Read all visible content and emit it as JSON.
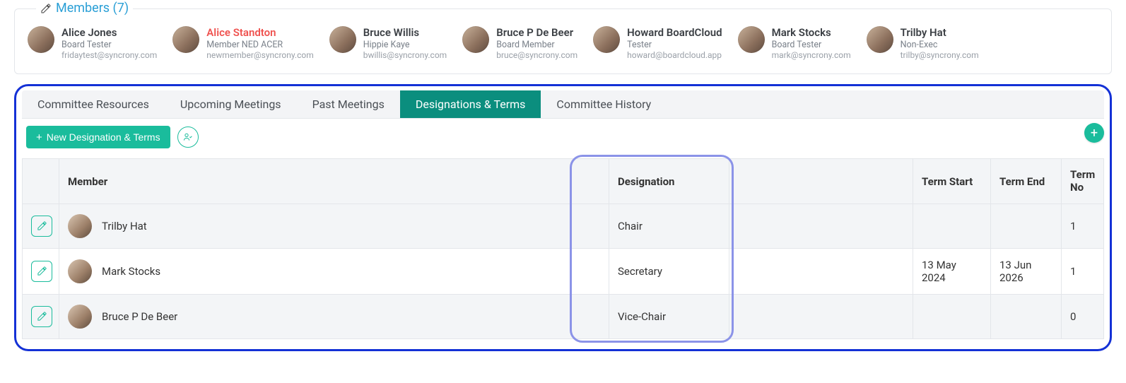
{
  "members_panel": {
    "title": "Members (7)",
    "items": [
      {
        "name": "Alice Jones",
        "role": "Board Tester",
        "email": "fridaytest@syncrony.com",
        "highlight": false
      },
      {
        "name": "Alice Standton",
        "role": "Member NED ACER",
        "email": "newmember@syncrony.com",
        "highlight": true
      },
      {
        "name": "Bruce Willis",
        "role": "Hippie Kaye",
        "email": "bwillis@syncrony.com",
        "highlight": false
      },
      {
        "name": "Bruce P De Beer",
        "role": "Board Member",
        "email": "bruce@syncrony.com",
        "highlight": false
      },
      {
        "name": "Howard BoardCloud",
        "role": "Tester",
        "email": "howard@boardcloud.app",
        "highlight": false
      },
      {
        "name": "Mark Stocks",
        "role": "Board Tester",
        "email": "mark@syncrony.com",
        "highlight": false
      },
      {
        "name": "Trilby Hat",
        "role": "Non-Exec",
        "email": "trilby@syncrony.com",
        "highlight": false
      }
    ]
  },
  "tabs": {
    "items": [
      {
        "label": "Committee Resources",
        "active": false
      },
      {
        "label": "Upcoming Meetings",
        "active": false
      },
      {
        "label": "Past Meetings",
        "active": false
      },
      {
        "label": "Designations & Terms",
        "active": true
      },
      {
        "label": "Committee History",
        "active": false
      }
    ]
  },
  "actions": {
    "new_designation_label": "New Designation & Terms"
  },
  "table": {
    "headers": {
      "member": "Member",
      "designation": "Designation",
      "term_start": "Term Start",
      "term_end": "Term End",
      "term_no": "Term No"
    },
    "rows": [
      {
        "member": "Trilby Hat",
        "designation": "Chair",
        "term_start": "",
        "term_end": "",
        "term_no": "1"
      },
      {
        "member": "Mark Stocks",
        "designation": "Secretary",
        "term_start": "13 May 2024",
        "term_end": "13 Jun 2026",
        "term_no": "1"
      },
      {
        "member": "Bruce P De Beer",
        "designation": "Vice-Chair",
        "term_start": "",
        "term_end": "",
        "term_no": "0"
      }
    ]
  }
}
